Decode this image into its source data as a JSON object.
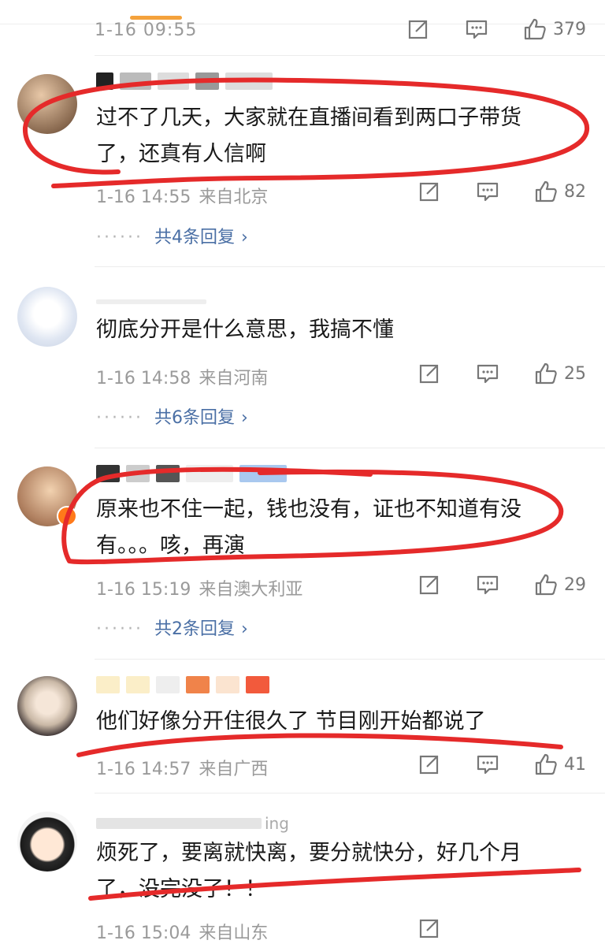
{
  "first_comment": {
    "date": "1-16 09:55",
    "likes": "379"
  },
  "comments": [
    {
      "text_line1": "过不了几天，大家就在直播间看到两口子带货",
      "text_line2": "了，还真有人信啊",
      "date": "1-16 14:55",
      "location": "来自北京",
      "likes": "82",
      "replies": "共4条回复"
    },
    {
      "text_line1": "彻底分开是什么意思，我搞不懂",
      "text_line2": "",
      "date": "1-16 14:58",
      "location": "来自河南",
      "likes": "25",
      "replies": "共6条回复"
    },
    {
      "text_line1": "原来也不住一起，钱也没有，证也不知道有没",
      "text_line2": "有。。。咳，再演",
      "date": "1-16 15:19",
      "location": "来自澳大利亚",
      "likes": "29",
      "replies": "共2条回复"
    },
    {
      "text_line1": "他们好像分开住很久了 节目刚开始都说了",
      "text_line2": "",
      "date": "1-16 14:57",
      "location": "来自广西",
      "likes": "41",
      "replies": ""
    },
    {
      "username_partial": "ing",
      "text_line1": "烦死了，要离就快离，要分就快分，好几个月",
      "text_line2": "了，没完没了！！",
      "date": "1-16 15:04",
      "location": "来自山东",
      "likes": "",
      "replies": ""
    }
  ],
  "ui": {
    "reply_dots": "······",
    "chevron": "›",
    "icons": [
      "share-icon",
      "comment-icon",
      "like-icon"
    ]
  },
  "colors": {
    "accent_tab": "#f4a23c",
    "meta_gray": "#9a9a9a",
    "link_blue": "#4a6fa5",
    "annotation_red": "#e52a2a"
  }
}
